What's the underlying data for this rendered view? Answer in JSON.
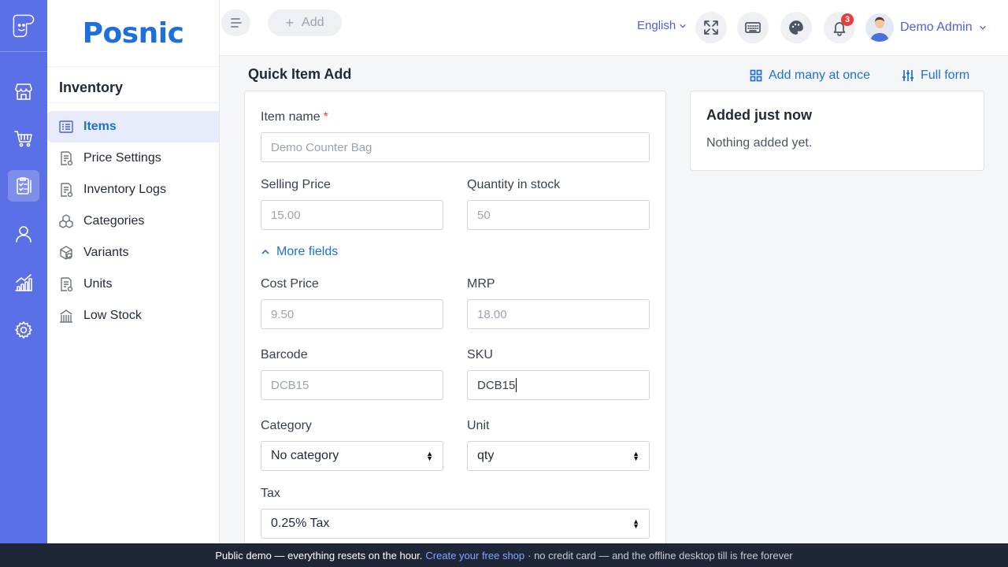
{
  "brand": {
    "name": "Posnic"
  },
  "rail": {
    "items": [
      {
        "icon": "store-icon"
      },
      {
        "icon": "cart-icon"
      },
      {
        "icon": "inventory-clipboard-icon",
        "active": true
      },
      {
        "icon": "user-icon"
      },
      {
        "icon": "reports-chart-icon"
      },
      {
        "icon": "settings-gear-icon"
      }
    ]
  },
  "nav": {
    "section_title": "Inventory",
    "items": [
      {
        "label": "Items",
        "icon": "items-list-icon",
        "active": true
      },
      {
        "label": "Price Settings",
        "icon": "price-settings-icon"
      },
      {
        "label": "Inventory Logs",
        "icon": "inventory-logs-icon"
      },
      {
        "label": "Categories",
        "icon": "categories-icon"
      },
      {
        "label": "Variants",
        "icon": "variants-icon"
      },
      {
        "label": "Units",
        "icon": "units-icon"
      },
      {
        "label": "Low Stock",
        "icon": "low-stock-icon"
      }
    ]
  },
  "topbar": {
    "add_label": "Add",
    "language": "English",
    "notification_count": "3",
    "user_name": "Demo Admin"
  },
  "page": {
    "title": "Quick Item Add",
    "add_many_label": "Add many at once",
    "full_form_label": "Full form"
  },
  "form": {
    "item_name": {
      "label": "Item name",
      "required_mark": "*",
      "placeholder": "Demo Counter Bag"
    },
    "selling_price": {
      "label": "Selling Price",
      "placeholder": "15.00"
    },
    "quantity": {
      "label": "Quantity in stock",
      "placeholder": "50"
    },
    "more_fields_label": "More fields",
    "cost_price": {
      "label": "Cost Price",
      "placeholder": "9.50"
    },
    "mrp": {
      "label": "MRP",
      "placeholder": "18.00"
    },
    "barcode": {
      "label": "Barcode",
      "placeholder": "DCB15"
    },
    "sku": {
      "label": "SKU",
      "value": "DCB15"
    },
    "category": {
      "label": "Category",
      "value": "No category"
    },
    "unit": {
      "label": "Unit",
      "value": "qty"
    },
    "tax": {
      "label": "Tax",
      "value": "0.25% Tax"
    }
  },
  "recent": {
    "title": "Added just now",
    "empty_text": "Nothing added yet."
  },
  "footer": {
    "text_before": "Public demo — everything resets on the hour.",
    "link_text": "Create your free shop",
    "text_after": "· no credit card — and the offline desktop till is free forever"
  }
}
